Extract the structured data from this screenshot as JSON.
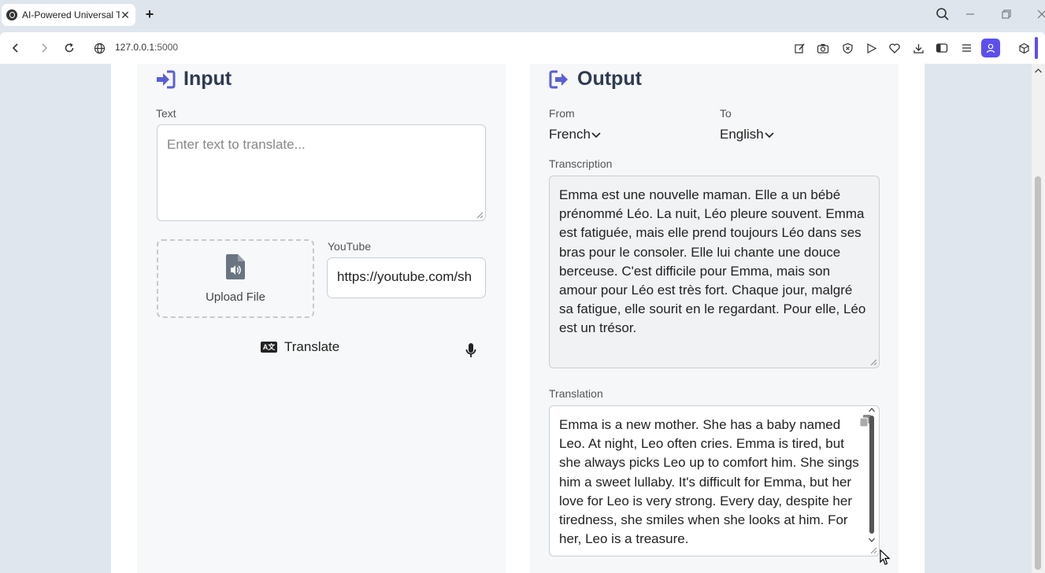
{
  "browser": {
    "tab_title": "AI-Powered Universal Tran",
    "tab_close": "✕",
    "new_tab": "+",
    "url_host": "127.0.0.1",
    "url_port": ":5000"
  },
  "input_panel": {
    "heading": "Input",
    "text_label": "Text",
    "text_placeholder": "Enter text to translate...",
    "upload_label": "Upload File",
    "youtube_label": "YouTube",
    "youtube_value": "https://youtube.com/sh",
    "translate_label": "Translate",
    "translate_icon_text": "A文"
  },
  "output_panel": {
    "heading": "Output",
    "from_label": "From",
    "from_value": "French",
    "to_label": "To",
    "to_value": "English",
    "transcription_label": "Transcription",
    "transcription_text": "Emma est une nouvelle maman. Elle a un bébé prénommé Léo. La nuit, Léo pleure souvent. Emma est fatiguée, mais elle prend toujours Léo dans ses bras pour le consoler. Elle lui chante une douce berceuse. C'est difficile pour Emma, mais son amour pour Léo est très fort. Chaque jour, malgré sa fatigue, elle sourit en le regardant. Pour elle, Léo est un trésor.",
    "translation_label": "Translation",
    "translation_text": "Emma is a new mother. She has a baby named Leo. At night, Leo often cries. Emma is tired, but she always picks Leo up to comfort him. She sings him a sweet lullaby. It's difficult for Emma, but her love for Leo is very strong. Every day, despite her tiredness, she smiles when she looks at him. For her, Leo is a treasure."
  },
  "colors": {
    "heading": "#2f3b52",
    "icon_accent": "#5b5fd6",
    "profile": "#5b4ff0"
  }
}
